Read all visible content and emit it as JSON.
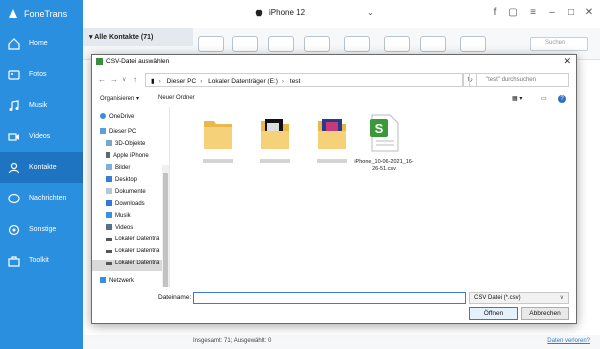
{
  "app": {
    "name": "FoneTrans"
  },
  "sidebar": {
    "items": [
      {
        "label": "Home",
        "icon": "home-icon"
      },
      {
        "label": "Fotos",
        "icon": "photos-icon"
      },
      {
        "label": "Musik",
        "icon": "music-icon"
      },
      {
        "label": "Videos",
        "icon": "video-icon"
      },
      {
        "label": "Kontakte",
        "icon": "contacts-icon",
        "active": true
      },
      {
        "label": "Nachrichten",
        "icon": "messages-icon"
      },
      {
        "label": "Sonstige",
        "icon": "other-icon"
      },
      {
        "label": "Toolkit",
        "icon": "toolkit-icon"
      }
    ]
  },
  "titlebar": {
    "device": "iPhone 12"
  },
  "main": {
    "category_header": "Alle Kontakte  (71)",
    "search_placeholder": "Suchen",
    "status_text": "Insgesamt: 71; Ausgewählt: 0",
    "status_link": "Daten verloren?"
  },
  "dialog": {
    "title": "CSV-Datei auswählen",
    "breadcrumb": [
      "Dieser PC",
      "Lokaler Datenträger (E:)",
      "test"
    ],
    "search_placeholder": "\"test\" durchsuchen",
    "commands": {
      "organize": "Organisieren ▾",
      "new_folder": "Neuer Ordner"
    },
    "tree": [
      {
        "label": "OneDrive",
        "icon": "cloud-icon"
      },
      {
        "label": "Dieser PC",
        "icon": "computer-icon"
      },
      {
        "label": "3D-Objekte",
        "icon": "cube-icon"
      },
      {
        "label": "Apple iPhone",
        "icon": "phone-icon"
      },
      {
        "label": "Bilder",
        "icon": "pictures-icon"
      },
      {
        "label": "Desktop",
        "icon": "desktop-icon"
      },
      {
        "label": "Dokumente",
        "icon": "documents-icon"
      },
      {
        "label": "Downloads",
        "icon": "downloads-icon"
      },
      {
        "label": "Musik",
        "icon": "music-icon"
      },
      {
        "label": "Videos",
        "icon": "videos-icon"
      },
      {
        "label": "Lokaler Datenträ",
        "icon": "drive-icon"
      },
      {
        "label": "Lokaler Datenträ",
        "icon": "drive-icon"
      },
      {
        "label": "Lokaler Datenträ",
        "icon": "drive-icon",
        "selected": true
      },
      {
        "label": "Netzwerk",
        "icon": "network-icon"
      }
    ],
    "files": [
      {
        "name": "",
        "kind": "folder"
      },
      {
        "name": "",
        "kind": "folder-images"
      },
      {
        "name": "",
        "kind": "folder-images-color"
      },
      {
        "name": "iPhone_10-06-2021_16-26-51.csv",
        "kind": "csv"
      }
    ],
    "filename_label": "Dateiname:",
    "filename_value": "",
    "filetype": "CSV Datei (*.csv)",
    "open_button": "Öffnen",
    "cancel_button": "Abbrechen"
  },
  "colors": {
    "sidebar": "#2b8fe0",
    "sidebar_active": "#1f74c2",
    "link": "#2b7cd3",
    "csv_green": "#3a9a3a"
  }
}
